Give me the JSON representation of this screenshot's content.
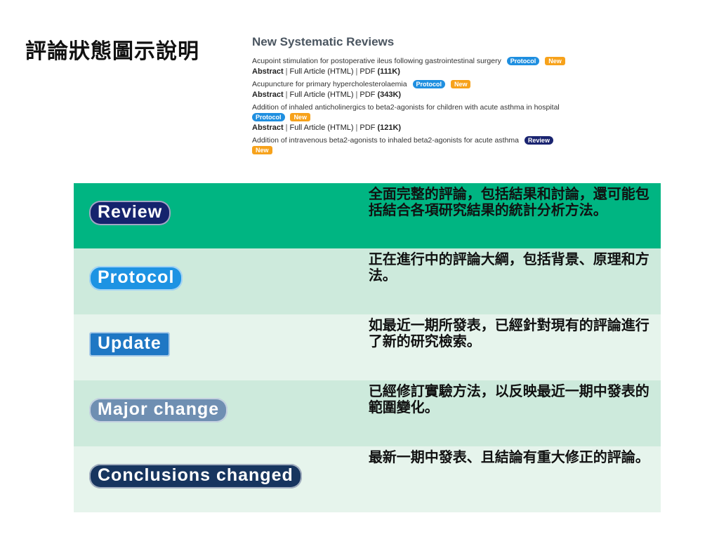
{
  "title": "評論狀態圖示說明",
  "panel": {
    "heading": "New Systematic Reviews",
    "items": [
      {
        "title": "Acupoint stimulation for postoperative ileus  following gastrointestinal surgery",
        "badge": "Protocol",
        "new": "New",
        "links": {
          "abstract": "Abstract",
          "full": "Full Article (HTML)",
          "pdf": "PDF",
          "size": "(111K)"
        }
      },
      {
        "title": "Acupuncture for primary hypercholesterolaemia",
        "badge": "Protocol",
        "new": "New",
        "links": {
          "abstract": "Abstract",
          "full": "Full Article (HTML)",
          "pdf": "PDF",
          "size": "(343K)"
        }
      },
      {
        "title": "Addition of inhaled anticholinergics to beta2-agonists for children with acute asthma in hospital",
        "badge": "Protocol",
        "new": "New",
        "links": {
          "abstract": "Abstract",
          "full": "Full Article (HTML)",
          "pdf": "PDF",
          "size": "(121K)"
        }
      },
      {
        "title": "Addition of intravenous beta2-agonists to inhaled beta2-agonists for acute asthma",
        "badge": "Review",
        "new": "New"
      }
    ]
  },
  "legend": [
    {
      "badge": "Review",
      "description": "全面完整的評論，包括結果和討論，還可能包括結合各項研究結果的統計分析方法。"
    },
    {
      "badge": "Protocol",
      "description": "正在進行中的評論大綱，包括背景、原理和方法。"
    },
    {
      "badge": "Update",
      "description": "如最近一期所發表，已經針對現有的評論進行了新的研究檢索。"
    },
    {
      "badge": "Major change",
      "description": "已經修訂實驗方法，以反映最近一期中發表的範圍變化。"
    },
    {
      "badge": "Conclusions changed",
      "description": "最新一期中發表、且結論有重大修正的評論。"
    }
  ],
  "colors": {
    "row_header": "#00b582",
    "row_alt_1": "#cdeadc",
    "row_alt_2": "#e6f4ec",
    "badge_review": "#15236d",
    "badge_protocol": "#1d93e3",
    "badge_update": "#1f77c4",
    "badge_major": "#6f8fb2",
    "badge_conclusions": "#17355f",
    "badge_new": "#f7a21b"
  }
}
